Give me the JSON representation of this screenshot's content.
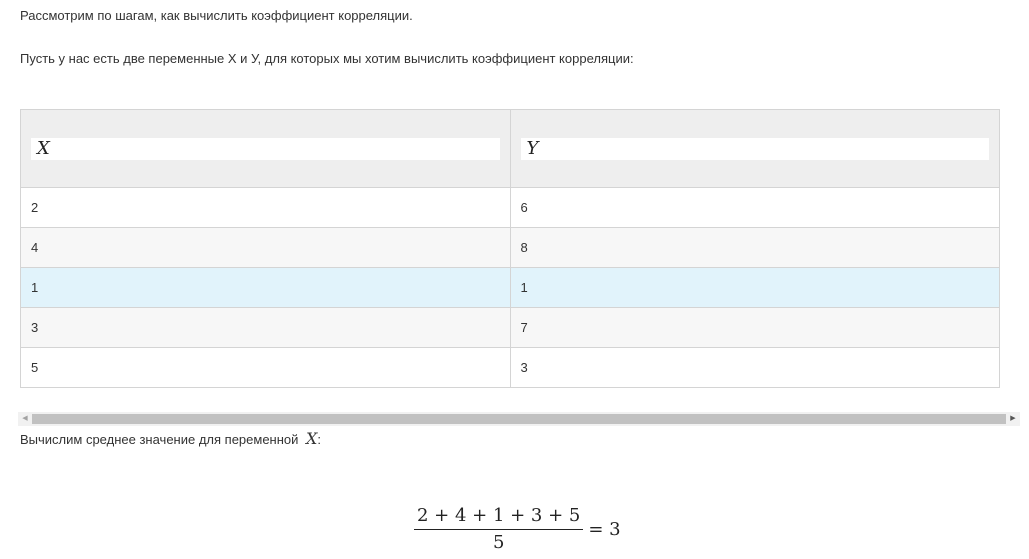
{
  "intro_text": "Рассмотрим по шагам, как вычислить коэффициент корреляции.",
  "lead_text": "Пусть у нас есть две переменные Х и У, для которых мы хотим вычислить коэффициент корреляции:",
  "table": {
    "headers": [
      "X",
      "Y"
    ],
    "rows": [
      [
        "2",
        "6"
      ],
      [
        "4",
        "8"
      ],
      [
        "1",
        "1"
      ],
      [
        "3",
        "7"
      ],
      [
        "5",
        "3"
      ]
    ],
    "highlighted_row_index": 2
  },
  "scrollbar": {
    "left_arrow": "◀",
    "right_arrow": "▶"
  },
  "mean_text": "Вычислим среднее значение для переменной",
  "mean_var": "X",
  "mean_colon": ":",
  "formula": {
    "numerator": "2 + 4 + 1 + 3 + 5",
    "denominator": "5",
    "result": "= 3"
  },
  "colors": {
    "header_bg": "#eeeeee",
    "highlight_row": "#e1f3fb",
    "alt_row": "#f7f7f7",
    "border": "#d4d4d4"
  }
}
